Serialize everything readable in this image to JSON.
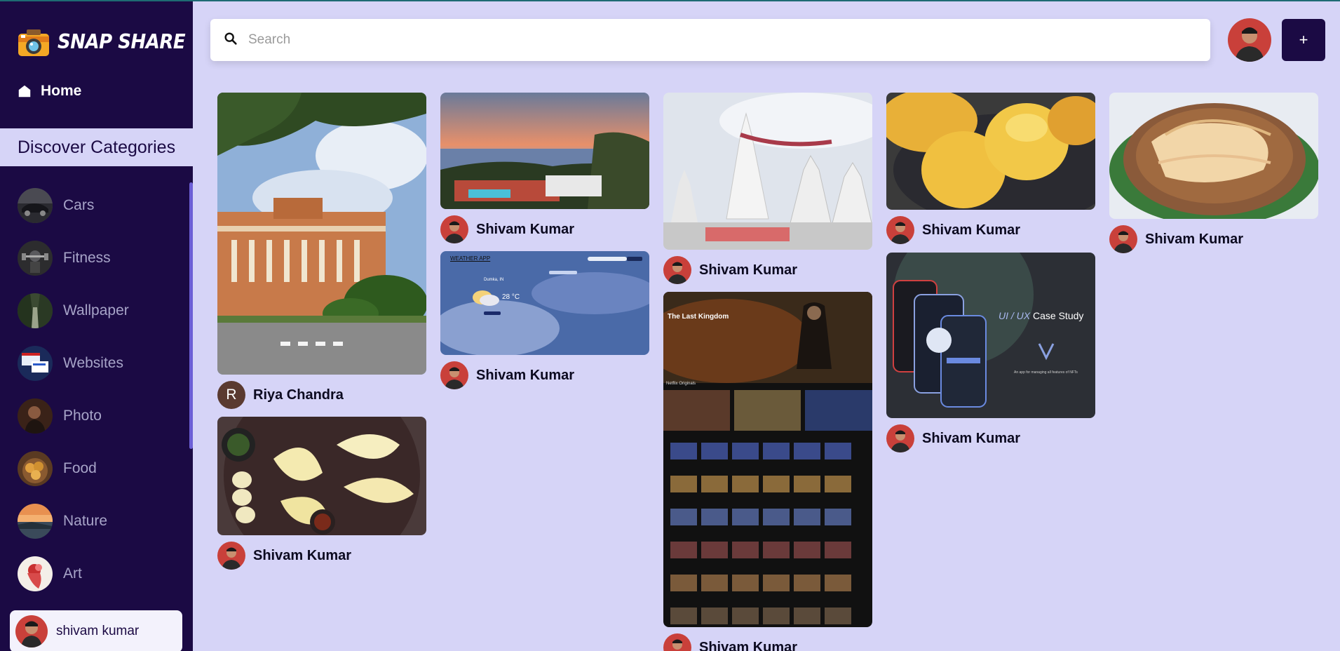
{
  "app": {
    "name": "SNAP SHARE"
  },
  "nav": {
    "home_label": "Home"
  },
  "discover": {
    "title": "Discover Categories"
  },
  "categories": [
    {
      "label": "Cars"
    },
    {
      "label": "Fitness"
    },
    {
      "label": "Wallpaper"
    },
    {
      "label": "Websites"
    },
    {
      "label": "Photo"
    },
    {
      "label": "Food"
    },
    {
      "label": "Nature"
    },
    {
      "label": "Art"
    }
  ],
  "current_user": {
    "name": "shivam kumar"
  },
  "search": {
    "placeholder": "Search",
    "value": ""
  },
  "add_button": {
    "label": "+"
  },
  "pins": [
    {
      "user": "Riya Chandra",
      "avatar_letter": "R"
    },
    {
      "user": "Shivam Kumar"
    },
    {
      "user": "Shivam Kumar"
    },
    {
      "user": "Shivam Kumar"
    },
    {
      "user": "Shivam Kumar"
    },
    {
      "user": "Shivam Kumar"
    },
    {
      "user": "Shivam Kumar"
    },
    {
      "user": "Shivam Kumar"
    },
    {
      "user": "Shivam Kumar"
    }
  ],
  "pin_texts": {
    "weather_app": "WEATHER APP",
    "weather_city": "Dumka, IN",
    "weather_temp": "28 °C",
    "movie_title": "The Last Kingdom",
    "movie_section": "Netflix Originals",
    "ux_title_a": "UI / UX",
    "ux_title_b": "Case Study",
    "ux_caption": "An app for managing all features of NFTs"
  },
  "colors": {
    "sidebar": "#1b0a44",
    "background": "#d6d4f7",
    "accent": "#6d5fd6"
  }
}
